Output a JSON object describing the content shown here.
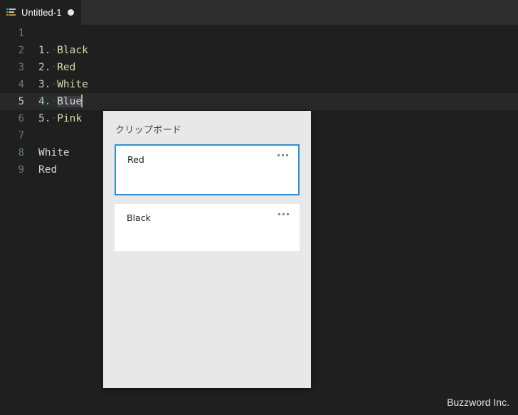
{
  "window": {
    "background_color": "#1f1f1f",
    "tabbar_color": "#2d2d2d"
  },
  "tabbar": {
    "tabs": [
      {
        "title": "Untitled-1",
        "icon": "text-file-icon",
        "dirty": true,
        "active": true
      }
    ]
  },
  "editor": {
    "active_line": 5,
    "selection_text": "Blue",
    "lines": [
      {
        "number": "1",
        "marker": "",
        "text": "",
        "active": false
      },
      {
        "number": "2",
        "marker": "1.",
        "text": "Black",
        "active": false
      },
      {
        "number": "3",
        "marker": "2.",
        "text": "Red",
        "active": false
      },
      {
        "number": "4",
        "marker": "3.",
        "text": "White",
        "active": false
      },
      {
        "number": "5",
        "marker": "4.",
        "text": "Blue",
        "active": true
      },
      {
        "number": "6",
        "marker": "5.",
        "text": "Pink",
        "active": false
      },
      {
        "number": "7",
        "marker": "",
        "text": "",
        "active": false
      },
      {
        "number": "8",
        "marker": "",
        "text": "White",
        "active": false
      },
      {
        "number": "9",
        "marker": "",
        "text": "Red",
        "active": false
      }
    ]
  },
  "clipboard_panel": {
    "title": "クリップボード",
    "background_color": "#e8e8e8",
    "selected_border_color": "#2f8fd4",
    "items": [
      {
        "text": "Red",
        "selected": true,
        "menu": "..."
      },
      {
        "text": "Black",
        "selected": false,
        "menu": "..."
      }
    ]
  },
  "footer": {
    "text": "Buzzword Inc."
  }
}
